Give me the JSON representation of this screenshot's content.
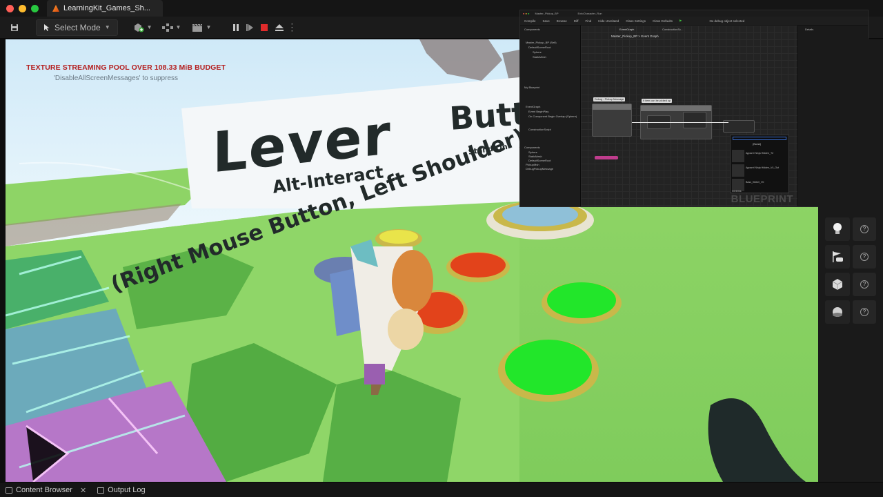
{
  "window": {
    "tab_title": "LearningKit_Games_Sh...",
    "traffic_colors": [
      "#ff5f57",
      "#febc2e",
      "#28c840"
    ]
  },
  "toolbar": {
    "save_icon": "save-icon",
    "select_mode_label": "Select Mode",
    "play_controls": [
      "pause-icon",
      "step-forward-icon",
      "stop-icon",
      "eject-icon"
    ],
    "stop_color": "#e02b2b"
  },
  "viewport": {
    "warning": "TEXTURE STREAMING POOL OVER 108.33 MiB BUDGET",
    "suppress_hint": "'DisableAllScreenMessages' to suppress",
    "signs": {
      "lever": "Lever",
      "alt_interact": "Alt-Interact",
      "right_mouse": "(Right Mouse Button, Left Shoulder)",
      "button": "Button",
      "stand_on": "Stand On"
    },
    "colors": {
      "ground": "#8ed466",
      "sky": "#dff1fb",
      "sign_text": "#222a2a",
      "button_green": "#22e62a",
      "button_red": "#e2431b",
      "button_rim": "#c5b025"
    }
  },
  "blueprint": {
    "watermark": "BLUEPRINT",
    "asset_tab": "Master_Pickup_BP",
    "second_tab": "ExtoCharacter_Run",
    "breadcrumb": "Master_Pickup_BP > Event Graph",
    "graph_tab": "EventGraph",
    "construction_tab": "ConstructionSc...",
    "debug_filter": "No debug object selected",
    "details_tab": "Details",
    "toolbar_items": [
      "Compile",
      "Save",
      "Browse",
      "Diff",
      "Find",
      "Hide Unrelated",
      "Class Settings",
      "Class Defaults"
    ],
    "components_header": "Components",
    "components": [
      "Master_Pickup_BP (Self)",
      "DefaultSceneRoot",
      "Sphere",
      "StaticMesh"
    ],
    "my_blueprint_header": "My Blueprint",
    "graphs": [
      "EventGraph",
      "Event BeginPlay",
      "On Component Begin Overlap (Sphere)"
    ],
    "functions": [
      "ConstructionScript"
    ],
    "variables": [
      "Components",
      "Sphere",
      "StaticMesh",
      "DefaultSceneRoot",
      "PickupMsh",
      "DebugPickupMessage"
    ],
    "comments": [
      "Debug - Pickup Message",
      "If item can be picked up"
    ],
    "dropdown_none": "(None)",
    "asset_items": [
      "Apparel Ninja Hidden_T2",
      "Apparel Ninja Hidden_V4_Out",
      "Bass_Kibbel_V0"
    ],
    "items_count": "34 items"
  },
  "place_actors": {
    "items": [
      "lightbulb-icon",
      "player-start-flag-icon",
      "cube-icon",
      "sphere-icon"
    ]
  },
  "bottom": {
    "content_browser": "Content Browser",
    "output_log": "Output Log"
  }
}
